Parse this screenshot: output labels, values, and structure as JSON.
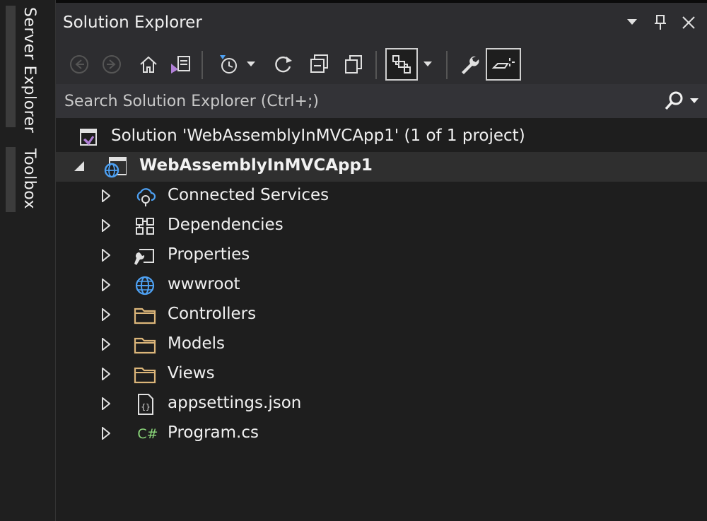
{
  "side_tabs": {
    "server_explorer": "Server Explorer",
    "toolbox": "Toolbox"
  },
  "panel": {
    "title": "Solution Explorer"
  },
  "search": {
    "placeholder": "Search Solution Explorer (Ctrl+;)"
  },
  "tree": {
    "solution": "Solution 'WebAssemblyInMVCApp1' (1 of 1 project)",
    "project": "WebAssemblyInMVCApp1",
    "items": [
      "Connected Services",
      "Dependencies",
      "Properties",
      "wwwroot",
      "Controllers",
      "Models",
      "Views",
      "appsettings.json",
      "Program.cs"
    ]
  },
  "icons": {
    "csharp_glyph": "C#",
    "json_glyph": "{}"
  },
  "colors": {
    "background": "#1e1e1e",
    "accent_purple": "#b180d7",
    "accent_blue": "#4ea1f3",
    "folder": "#dcb67a",
    "csharp": "#8ad67a"
  }
}
